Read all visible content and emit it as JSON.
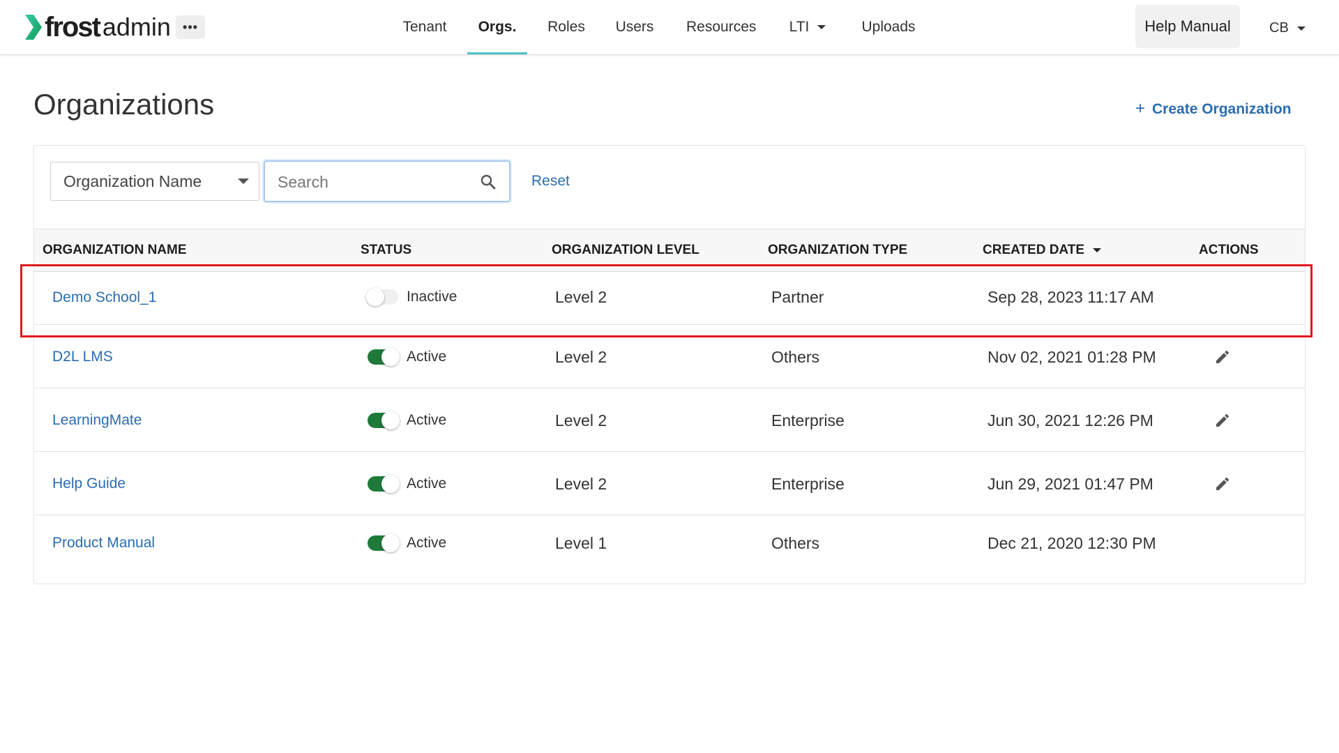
{
  "app": {
    "logo_bold": "frost",
    "logo_light": "admin",
    "more_label": "•••"
  },
  "nav": {
    "items": [
      {
        "label": "Tenant",
        "active": false
      },
      {
        "label": "Orgs.",
        "active": true
      },
      {
        "label": "Roles",
        "active": false
      },
      {
        "label": "Users",
        "active": false
      },
      {
        "label": "Resources",
        "active": false
      },
      {
        "label": "LTI",
        "active": false,
        "has_dropdown": true
      },
      {
        "label": "Uploads",
        "active": false
      }
    ],
    "help_label": "Help Manual",
    "user_initials": "CB"
  },
  "page": {
    "title": "Organizations",
    "create_label": "Create Organization",
    "create_icon": "plus-icon"
  },
  "filter": {
    "field_selected": "Organization Name",
    "search_placeholder": "Search",
    "search_value": "",
    "reset_label": "Reset"
  },
  "table": {
    "headers": {
      "name": "ORGANIZATION NAME",
      "status": "STATUS",
      "level": "ORGANIZATION LEVEL",
      "type": "ORGANIZATION TYPE",
      "created": "CREATED DATE",
      "actions": "ACTIONS"
    },
    "sort_column": "created",
    "sort_direction": "descending",
    "rows": [
      {
        "name": "Demo School_1",
        "active": false,
        "status": "Inactive",
        "level": "Level 2",
        "type": "Partner",
        "created": "Sep 28, 2023 11:17 AM",
        "editable": false
      },
      {
        "name": "D2L LMS",
        "active": true,
        "status": "Active",
        "level": "Level 2",
        "type": "Others",
        "created": "Nov 02, 2021 01:28 PM",
        "editable": true
      },
      {
        "name": "LearningMate",
        "active": true,
        "status": "Active",
        "level": "Level 2",
        "type": "Enterprise",
        "created": "Jun 30, 2021 12:26 PM",
        "editable": true
      },
      {
        "name": "Help Guide",
        "active": true,
        "status": "Active",
        "level": "Level 2",
        "type": "Enterprise",
        "created": "Jun 29, 2021 01:47 PM",
        "editable": true
      },
      {
        "name": "Product Manual",
        "active": true,
        "status": "Active",
        "level": "Level 1",
        "type": "Others",
        "created": "Dec 21, 2020 12:30 PM",
        "editable": false
      }
    ]
  },
  "colors": {
    "link": "#2b6cb0",
    "toggle_on": "#1f7a3a",
    "active_tab_underline": "#4cc3c9",
    "highlight": "#e0171e",
    "logo_chevron": "#1aa86a"
  }
}
